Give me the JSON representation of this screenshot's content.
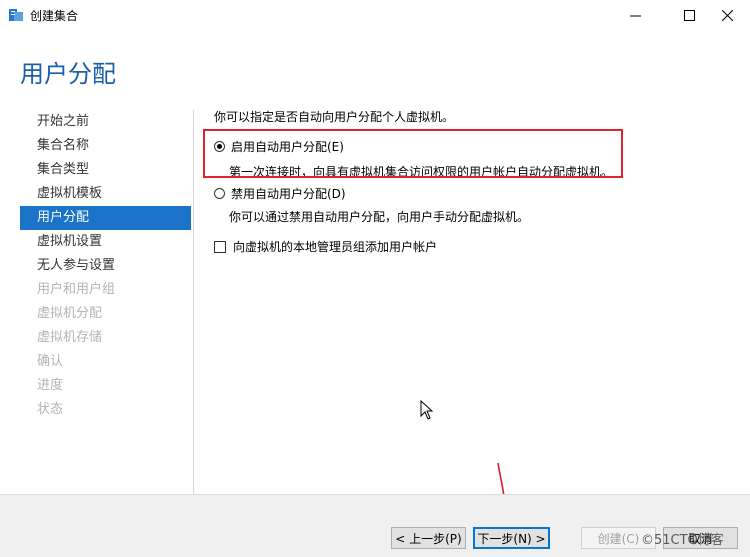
{
  "window": {
    "title": "创建集合",
    "controls": [
      "minimize-icon",
      "maximize-icon",
      "close-icon"
    ]
  },
  "page_title": "用户分配",
  "nav": {
    "items": [
      {
        "label": "开始之前",
        "state": "normal"
      },
      {
        "label": "集合名称",
        "state": "normal"
      },
      {
        "label": "集合类型",
        "state": "normal"
      },
      {
        "label": "虚拟机模板",
        "state": "normal"
      },
      {
        "label": "用户分配",
        "state": "active"
      },
      {
        "label": "虚拟机设置",
        "state": "normal"
      },
      {
        "label": "无人参与设置",
        "state": "normal"
      },
      {
        "label": "用户和用户组",
        "state": "disabled"
      },
      {
        "label": "虚拟机分配",
        "state": "disabled"
      },
      {
        "label": "虚拟机存储",
        "state": "disabled"
      },
      {
        "label": "确认",
        "state": "disabled"
      },
      {
        "label": "进度",
        "state": "disabled"
      },
      {
        "label": "状态",
        "state": "disabled"
      }
    ]
  },
  "content": {
    "intro": "你可以指定是否自动向用户分配个人虚拟机。",
    "option_auto": {
      "label": "启用自动用户分配(E)",
      "selected": true,
      "description": "第一次连接时，向具有虚拟机集合访问权限的用户帐户自动分配虚拟机。"
    },
    "option_manual": {
      "label": "禁用自动用户分配(D)",
      "selected": false,
      "description": "你可以通过禁用自动用户分配，向用户手动分配虚拟机。"
    },
    "checkbox_admin": {
      "label": "向虚拟机的本地管理员组添加用户帐户",
      "checked": false
    }
  },
  "footer": {
    "prev": "< 上一步(P)",
    "next": "下一步(N) >",
    "create": "创建(C)",
    "cancel": "取消"
  },
  "watermark": "©51CTO博客",
  "colors": {
    "accent": "#1a73c7",
    "title": "#1a5fa8",
    "highlight": "#e0242f"
  }
}
